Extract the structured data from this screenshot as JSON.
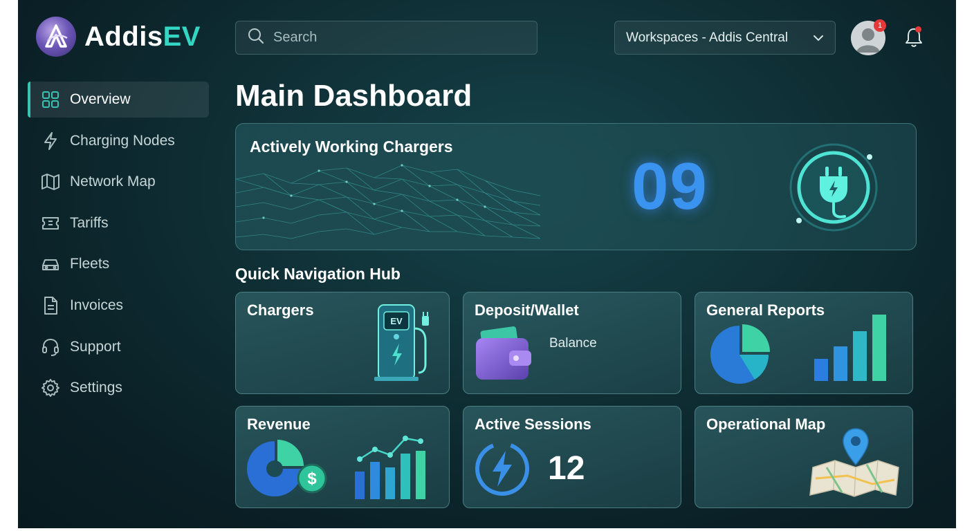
{
  "header": {
    "brand_main": "Addis",
    "brand_accent": "EV",
    "search_placeholder": "Search",
    "workspace_label": "Workspaces - Addis Central",
    "notification_count": "1"
  },
  "sidebar": {
    "items": [
      {
        "label": "Overview",
        "icon": "grid-icon",
        "active": true
      },
      {
        "label": "Charging Nodes",
        "icon": "lightning-icon"
      },
      {
        "label": "Network Map",
        "icon": "map-icon"
      },
      {
        "label": "Tariffs",
        "icon": "ticket-icon"
      },
      {
        "label": "Fleets",
        "icon": "car-icon"
      },
      {
        "label": "Invoices",
        "icon": "document-icon"
      },
      {
        "label": "Support",
        "icon": "headset-icon"
      },
      {
        "label": "Settings",
        "icon": "gear-icon"
      }
    ]
  },
  "main": {
    "title": "Main Dashboard",
    "hero": {
      "title": "Actively Working Chargers",
      "count": "09"
    },
    "hub_title": "Quick Navigation Hub",
    "cards": {
      "chargers": {
        "title": "Chargers",
        "ev_label": "EV"
      },
      "wallet": {
        "title": "Deposit/Wallet",
        "sub": "Balance"
      },
      "reports": {
        "title": "General Reports"
      },
      "revenue": {
        "title": "Revenue",
        "currency_symbol": "$"
      },
      "sessions": {
        "title": "Active Sessions",
        "count": "12"
      },
      "map": {
        "title": "Operational Map"
      }
    }
  },
  "colors": {
    "accent": "#33d6c2",
    "active_bar": "#3ac2b3",
    "alert": "#e53a3a",
    "count_blue": "#3b93f0"
  }
}
